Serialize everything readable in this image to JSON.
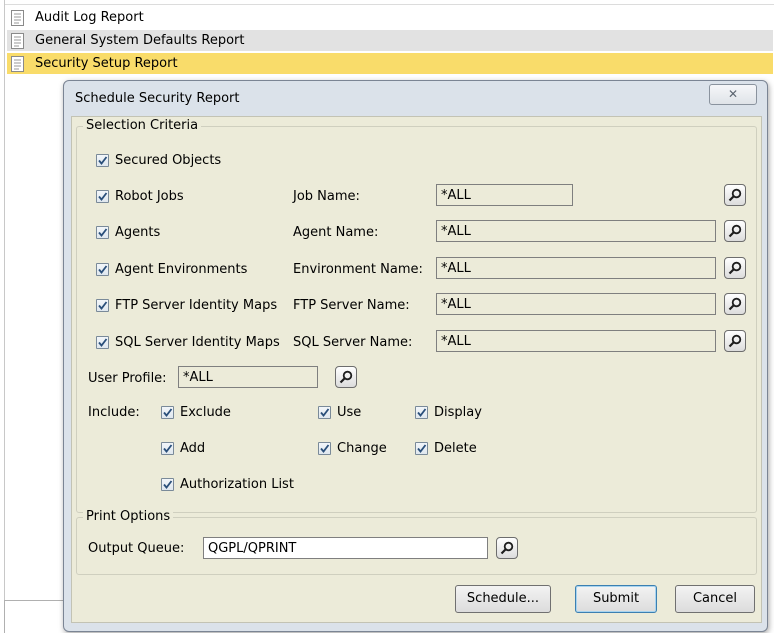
{
  "reports": [
    {
      "label": "Audit Log Report"
    },
    {
      "label": "General System Defaults Report"
    },
    {
      "label": "Security Setup Report"
    }
  ],
  "dialog": {
    "title": "Schedule Security Report",
    "close_glyph": "✕",
    "selection_criteria": {
      "legend": "Selection Criteria",
      "secured_objects": "Secured Objects",
      "rows": [
        {
          "checkbox": "Robot Jobs",
          "field_label": "Job Name:",
          "value": "*ALL"
        },
        {
          "checkbox": "Agents",
          "field_label": "Agent Name:",
          "value": "*ALL"
        },
        {
          "checkbox": "Agent Environments",
          "field_label": "Environment Name:",
          "value": "*ALL"
        },
        {
          "checkbox": "FTP Server Identity Maps",
          "field_label": "FTP Server Name:",
          "value": "*ALL"
        },
        {
          "checkbox": "SQL Server Identity Maps",
          "field_label": "SQL Server Name:",
          "value": "*ALL"
        }
      ],
      "user_profile_label": "User Profile:",
      "user_profile_value": "*ALL",
      "include_label": "Include:",
      "include_options": [
        "Exclude",
        "Use",
        "Display",
        "Add",
        "Change",
        "Delete",
        "Authorization List"
      ]
    },
    "print_options": {
      "legend": "Print Options",
      "output_queue_label": "Output Queue:",
      "output_queue_value": "QGPL/QPRINT"
    },
    "buttons": {
      "schedule": "Schedule...",
      "submit": "Submit",
      "cancel": "Cancel"
    }
  },
  "colors": {
    "selected_row": "#f9dc6a",
    "alt_row": "#e2e2e2",
    "dialog_bg": "#ecebd9",
    "check_mark": "#2a4f7a"
  }
}
